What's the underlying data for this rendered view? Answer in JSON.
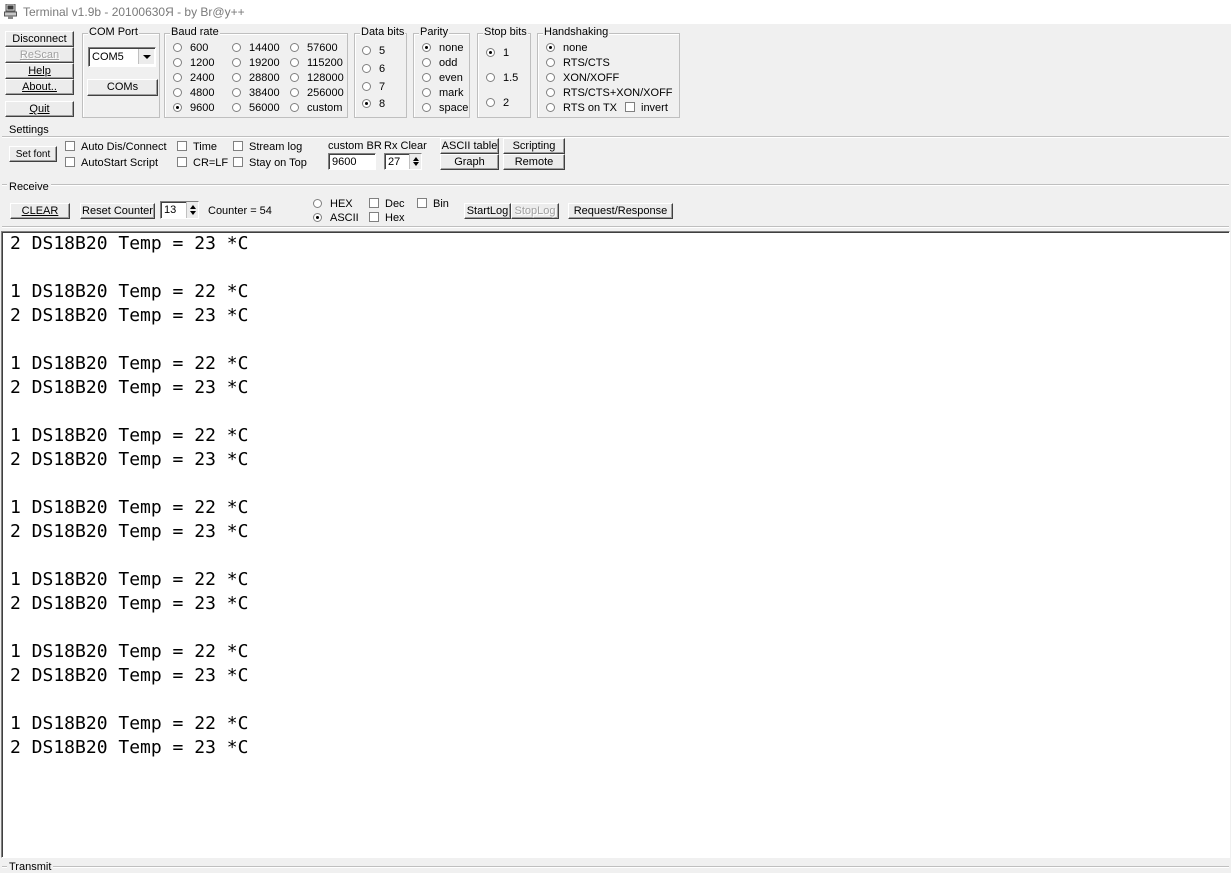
{
  "window": {
    "title": "Terminal v1.9b - 20100630Я - by Br@y++",
    "icon": "terminal-app-icon"
  },
  "connection_buttons": {
    "disconnect": "Disconnect",
    "rescan": "ReScan",
    "help": "Help",
    "about": "About..",
    "quit": "Quit"
  },
  "com_port": {
    "label": "COM Port",
    "value": "COM5",
    "coms_button": "COMs"
  },
  "baud_rate": {
    "label": "Baud rate",
    "options": [
      "600",
      "1200",
      "2400",
      "4800",
      "9600",
      "14400",
      "19200",
      "28800",
      "38400",
      "56000",
      "57600",
      "115200",
      "128000",
      "256000",
      "custom"
    ],
    "selected": "9600"
  },
  "data_bits": {
    "label": "Data bits",
    "options": [
      "5",
      "6",
      "7",
      "8"
    ],
    "selected": "8"
  },
  "parity": {
    "label": "Parity",
    "options": [
      "none",
      "odd",
      "even",
      "mark",
      "space"
    ],
    "selected": "none"
  },
  "stop_bits": {
    "label": "Stop bits",
    "options": [
      "1",
      "1.5",
      "2"
    ],
    "selected": "1"
  },
  "handshaking": {
    "label": "Handshaking",
    "options": [
      "none",
      "RTS/CTS",
      "XON/XOFF",
      "RTS/CTS+XON/XOFF",
      "RTS on TX"
    ],
    "selected": "none",
    "invert_label": "invert"
  },
  "settings": {
    "label": "Settings",
    "set_font": "Set font",
    "auto_dis_connect": "Auto Dis/Connect",
    "autostart_script": "AutoStart Script",
    "time": "Time",
    "cr_lf": "CR=LF",
    "stream_log": "Stream log",
    "stay_on_top": "Stay on Top",
    "custom_br_label": "custom BR",
    "custom_br_value": "9600",
    "rx_clear_label": "Rx Clear",
    "rx_clear_value": "27",
    "ascii_table": "ASCII table",
    "scripting": "Scripting",
    "graph": "Graph",
    "remote": "Remote"
  },
  "receive": {
    "label": "Receive",
    "clear": "CLEAR",
    "reset_counter": "Reset Counter",
    "counter_value": "13",
    "counter_text": "Counter = 54",
    "hex": "HEX",
    "ascii": "ASCII",
    "selected_mode": "ASCII",
    "dec": "Dec",
    "hex_chk": "Hex",
    "bin": "Bin",
    "start_log": "StartLog",
    "stop_log": "StopLog",
    "request_response": "Request/Response"
  },
  "output_lines": [
    "2 DS18B20 Temp = 23 *C",
    "",
    "1 DS18B20 Temp = 22 *C",
    "2 DS18B20 Temp = 23 *C",
    "",
    "1 DS18B20 Temp = 22 *C",
    "2 DS18B20 Temp = 23 *C",
    "",
    "1 DS18B20 Temp = 22 *C",
    "2 DS18B20 Temp = 23 *C",
    "",
    "1 DS18B20 Temp = 22 *C",
    "2 DS18B20 Temp = 23 *C",
    "",
    "1 DS18B20 Temp = 22 *C",
    "2 DS18B20 Temp = 23 *C",
    "",
    "1 DS18B20 Temp = 22 *C",
    "2 DS18B20 Temp = 23 *C",
    "",
    "1 DS18B20 Temp = 22 *C",
    "2 DS18B20 Temp = 23 *C"
  ],
  "transmit": {
    "label": "Transmit"
  }
}
